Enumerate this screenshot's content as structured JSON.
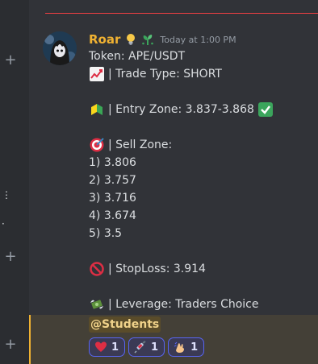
{
  "message": {
    "author": "Roar",
    "timestamp": "Today at 1:00 PM",
    "lines": {
      "token": "Token: APE/USDT",
      "trade_type": "| Trade Type: SHORT",
      "entry_zone": "| Entry Zone: 3.837-3.868",
      "sell_zone": "| Sell Zone:",
      "sell_1": "1) 3.806",
      "sell_2": "2) 3.757",
      "sell_3": "3) 3.716",
      "sell_4": "4) 3.674",
      "sell_5": "5) 3.5",
      "stoploss": "| StopLoss: 3.914",
      "leverage": "| Leverage: Traders Choice"
    },
    "mention": "@Students",
    "reactions": [
      {
        "emoji": "heart-icon",
        "count": "1"
      },
      {
        "emoji": "syringe-icon",
        "count": "1"
      },
      {
        "emoji": "hand-icon",
        "count": "1"
      }
    ]
  },
  "colors": {
    "background": "#313338",
    "username": "#f0b232",
    "accent": "#5865f2",
    "mention_bg": "#5a4c2a"
  }
}
